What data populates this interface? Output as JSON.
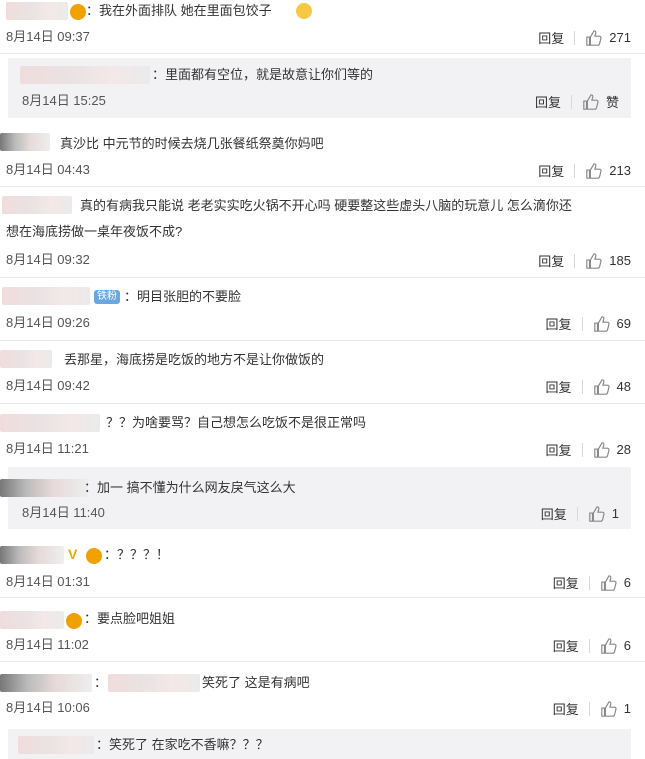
{
  "comments": [
    {
      "text": "：我在外面排队 她在里面包饺子",
      "date": "8月14日 09:37",
      "reply_label": "回复",
      "likes": "271"
    },
    {
      "text": "：里面都有空位，就是故意让你们等的",
      "date": "8月14日 15:25",
      "reply_label": "回复",
      "likes": "赞"
    },
    {
      "text": "真沙比 中元节的时候去烧几张餐纸祭奠你妈吧",
      "date": "8月14日 04:43",
      "reply_label": "回复",
      "likes": "213"
    },
    {
      "text_line1": "真的有病我只能说 老老实实吃火锅不开心吗 硬要整这些虚头八脑的玩意儿 怎么滴你还",
      "text_line2": "想在海底捞做一桌年夜饭不成?",
      "date": "8月14日 09:32",
      "reply_label": "回复",
      "likes": "185"
    },
    {
      "badge": "铁粉",
      "text": "：明目张胆的不要脸",
      "date": "8月14日 09:26",
      "reply_label": "回复",
      "likes": "69"
    },
    {
      "text": "丢那星，海底捞是吃饭的地方不是让你做饭的",
      "date": "8月14日 09:42",
      "reply_label": "回复",
      "likes": "48"
    },
    {
      "text": "？？为啥要骂？自己想怎么吃饭不是很正常吗",
      "date": "8月14日 11:21",
      "reply_label": "回复",
      "likes": "28"
    },
    {
      "text": "：加一 搞不懂为什么网友戾气这么大",
      "date": "8月14日 11:40",
      "reply_label": "回复",
      "likes": "1"
    },
    {
      "text": "：？？？！",
      "date": "8月14日 01:31",
      "reply_label": "回复",
      "likes": "6"
    },
    {
      "text": "：要点脸吧姐姐",
      "date": "8月14日 11:02",
      "reply_label": "回复",
      "likes": "6"
    },
    {
      "prefix": "：",
      "text": "笑死了 这是有病吧",
      "date": "8月14日 10:06",
      "reply_label": "回复",
      "likes": "1"
    },
    {
      "text": "：笑死了 在家吃不香嘛？？？"
    }
  ]
}
